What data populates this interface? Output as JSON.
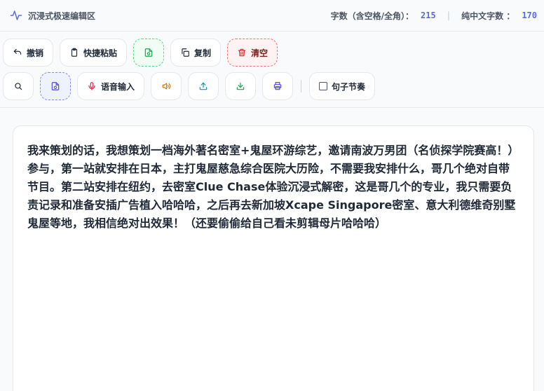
{
  "header": {
    "title": "沉浸式极速编辑区",
    "icon": "pulse-icon",
    "char_count_label": "字数（含空格/全角）：",
    "char_count_value": "215",
    "pure_chinese_label": "纯中文字数 ：",
    "pure_chinese_value": "170"
  },
  "toolbar1": {
    "undo_label": "撤销",
    "paste_label": "快捷粘贴",
    "copy_label": "复制",
    "clear_label": "清空"
  },
  "toolbar2": {
    "voice_label": "语音输入",
    "sentence_rhythm_label": "句子节奏"
  },
  "editor": {
    "content": "我来策划的话，我想策划一档海外著名密室+鬼屋环游综艺，邀请南波万男团（名侦探学院赛高！）参与，第一站就安排在日本，主打鬼屋慈急综合医院大历险，不需要我安排什么，哥几个绝对自带节目。第二站安排在纽约，去密室Clue Chase体验沉浸式解密，这是哥几个的专业，我只需要负责记录和准备安插广告植入哈哈哈，之后再去新加坡Xcape Singapore密室、意大利德维奇别墅鬼屋等地，我相信绝对出效果！（还要偷偷给自己看未剪辑母片哈哈哈）"
  },
  "colors": {
    "accent": "#5b6dde",
    "danger": "#dc2626",
    "success": "#16a34a",
    "voice": "#e11d48",
    "sound": "#d97706",
    "upload": "#0891b2",
    "download": "#16a34a",
    "print": "#4f46e5"
  }
}
